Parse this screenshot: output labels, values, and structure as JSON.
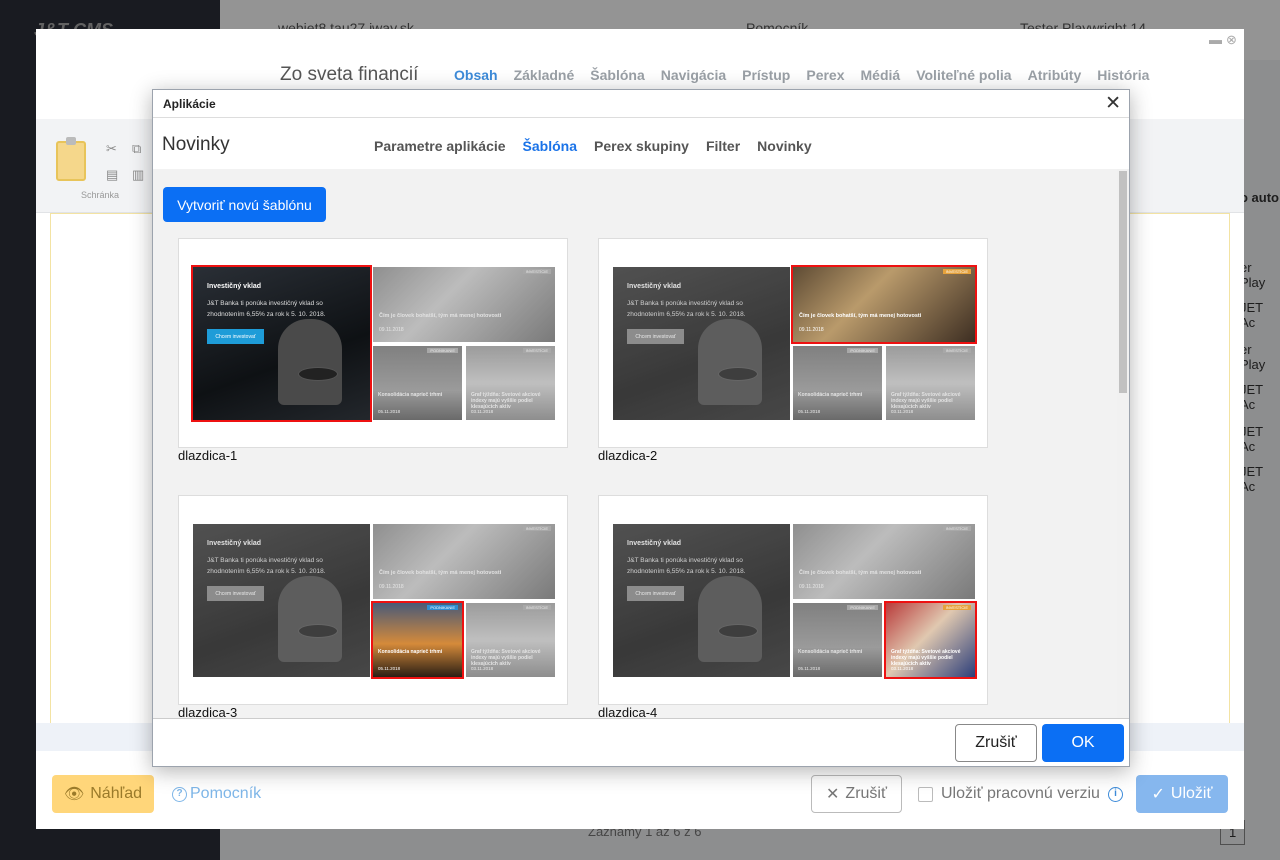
{
  "background": {
    "logo": "J&T CMS",
    "domain": "webjet8.tau27.iway.sk",
    "help_label": "Pomocník",
    "user": "Tester Playwright 14",
    "right_column": [
      "o auto",
      "er Play",
      "JET Ac",
      "er Play",
      "JET Ac",
      "JET Ac",
      "JET Ac"
    ],
    "pager_text": "Záznamy 1 až 6 z 6",
    "page_number": "1"
  },
  "editor": {
    "title": "Zo sveta financií",
    "tabs": [
      {
        "label": "Obsah",
        "active": true
      },
      {
        "label": "Základné"
      },
      {
        "label": "Šablóna"
      },
      {
        "label": "Navigácia"
      },
      {
        "label": "Prístup"
      },
      {
        "label": "Perex"
      },
      {
        "label": "Médiá"
      },
      {
        "label": "Voliteľné polia"
      },
      {
        "label": "Atribúty"
      },
      {
        "label": "História"
      }
    ],
    "ribbon_label": "Schránka",
    "footer": {
      "preview_label": "Náhľad",
      "help_label": "Pomocník",
      "cancel_label": "Zrušiť",
      "save_version_label": "Uložiť pracovnú verziu",
      "save_label": "Uložiť"
    }
  },
  "dialog": {
    "title": "Aplikácie",
    "app_name": "Novinky",
    "tabs": [
      {
        "label": "Parametre aplikácie"
      },
      {
        "label": "Šablóna",
        "active": true
      },
      {
        "label": "Perex skupiny"
      },
      {
        "label": "Filter"
      },
      {
        "label": "Novinky"
      }
    ],
    "new_template_label": "Vytvoriť novú šablónu",
    "preview_texts": {
      "big_title": "Investičný vklad",
      "big_text": "J&T Banka ti ponúka investičný vklad so zhodnotením 6,55% za rok k 5. 10. 2018.",
      "big_button": "Chcem investovať",
      "top_title": "Čím je človek bohatší, tým má menej hotovosti",
      "top_date": "09.11.2018",
      "top_tag": "INVESTÍCIE",
      "sm1_title": "Konsolidácia naprieč trhmi",
      "sm1_date": "05.11.2018",
      "sm1_tag": "PODNIKANIE",
      "sm2_title": "Graf týždňa: Svetové akciové indexy majú vyššie podiel klesajúcich aktív",
      "sm2_date": "03.11.2018",
      "sm2_tag": "INVESTÍCIE"
    },
    "templates": [
      {
        "name": "dlazdica-1",
        "highlight": "big"
      },
      {
        "name": "dlazdica-2",
        "highlight": "top"
      },
      {
        "name": "dlazdica-3",
        "highlight": "sm1"
      },
      {
        "name": "dlazdica-4",
        "highlight": "sm2"
      }
    ],
    "cancel_label": "Zrušiť",
    "ok_label": "OK"
  }
}
